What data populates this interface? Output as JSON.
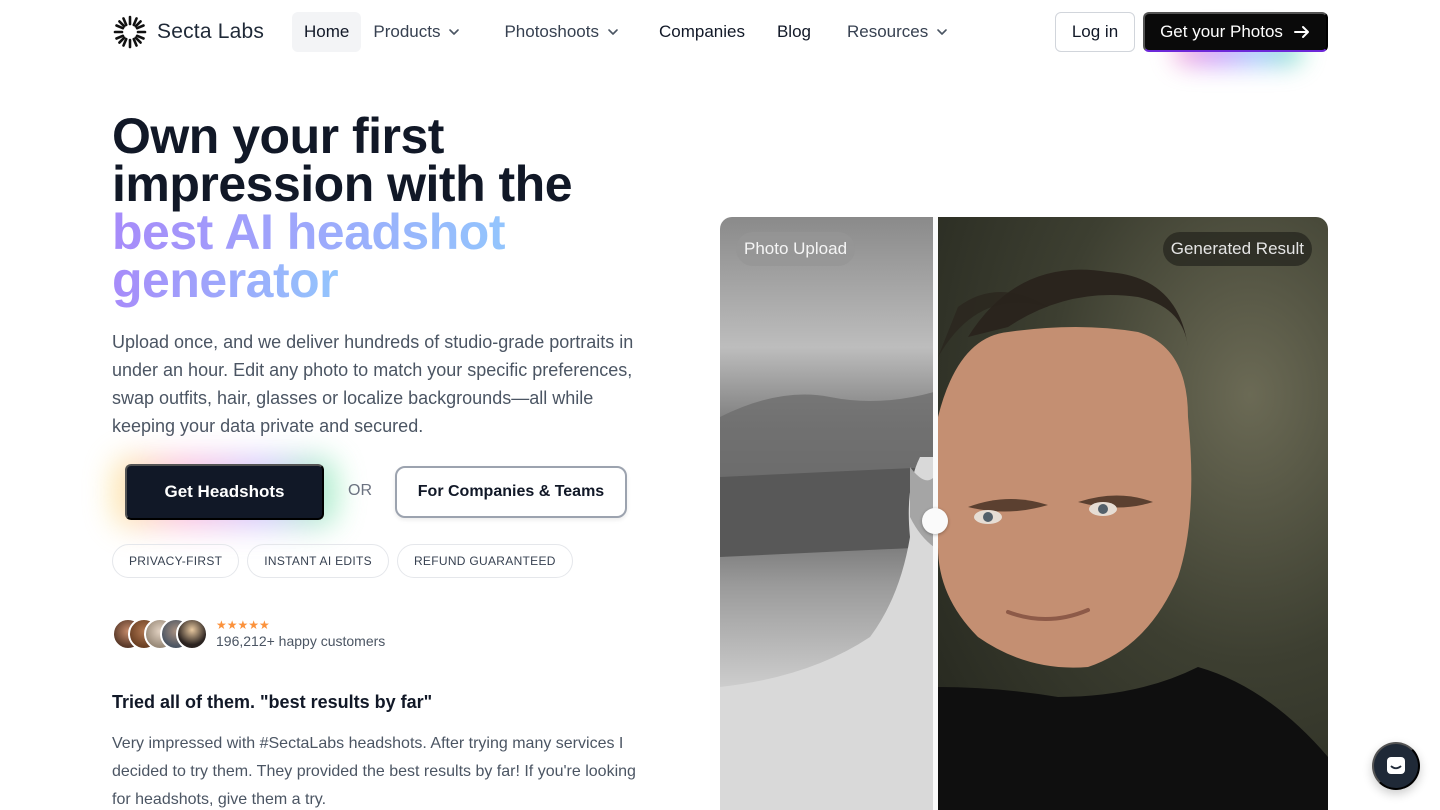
{
  "brand": {
    "name": "Secta Labs"
  },
  "nav": {
    "items": [
      {
        "label": "Home",
        "has_menu": false
      },
      {
        "label": "Products",
        "has_menu": true
      },
      {
        "label": "Photoshoots",
        "has_menu": true
      },
      {
        "label": "Companies",
        "has_menu": false
      },
      {
        "label": "Blog",
        "has_menu": false
      },
      {
        "label": "Resources",
        "has_menu": true
      }
    ],
    "login_label": "Log in",
    "cta_label": "Get your Photos"
  },
  "hero": {
    "title_line1": "Own your first",
    "title_line2": "impression with the",
    "title_highlight1": "best AI headshot",
    "title_highlight2": "generator",
    "description": "Upload once, and we deliver hundreds of studio-grade portraits in under an hour. Edit any photo to match your specific preferences, swap outfits, hair, glasses or localize backgrounds—all while keeping your data private and secured.",
    "primary_cta": "Get Headshots",
    "or_text": "OR",
    "secondary_cta": "For Companies & Teams",
    "badges": [
      "PRIVACY-FIRST",
      "INSTANT AI EDITS",
      "REFUND GUARANTEED"
    ],
    "rating_stars": "★★★★★",
    "customers_text": "196,212+ happy customers"
  },
  "testimonial": {
    "title": "Tried all of them. \"best results by far\"",
    "body": "Very impressed with #SectaLabs headshots. After trying many services I decided to try them. They provided the best results by far! If you're looking for headshots, give them a try."
  },
  "compare": {
    "left_label": "Photo Upload",
    "right_label": "Generated Result"
  },
  "colors": {
    "accent_start": "#a78bfa",
    "accent_end": "#93c5fd",
    "primary_button": "#111827",
    "star": "#fb923c"
  }
}
